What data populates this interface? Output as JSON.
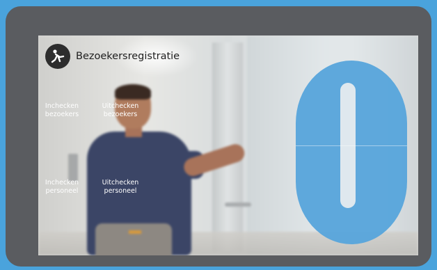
{
  "header": {
    "title": "Bezoekersregistratie",
    "logo_icon": "person-walking-icon"
  },
  "options": [
    {
      "line1": "Inchecken",
      "line2": "bezoekers"
    },
    {
      "line1": "Uitchecken",
      "line2": "bezoekers"
    },
    {
      "line1": "Inchecken",
      "line2": "personeel"
    },
    {
      "line1": "Uitchecken",
      "line2": "personeel"
    }
  ],
  "colors": {
    "background": "#4aa3dc",
    "device_frame": "#5a5c60",
    "accent": "#59a6dc"
  }
}
